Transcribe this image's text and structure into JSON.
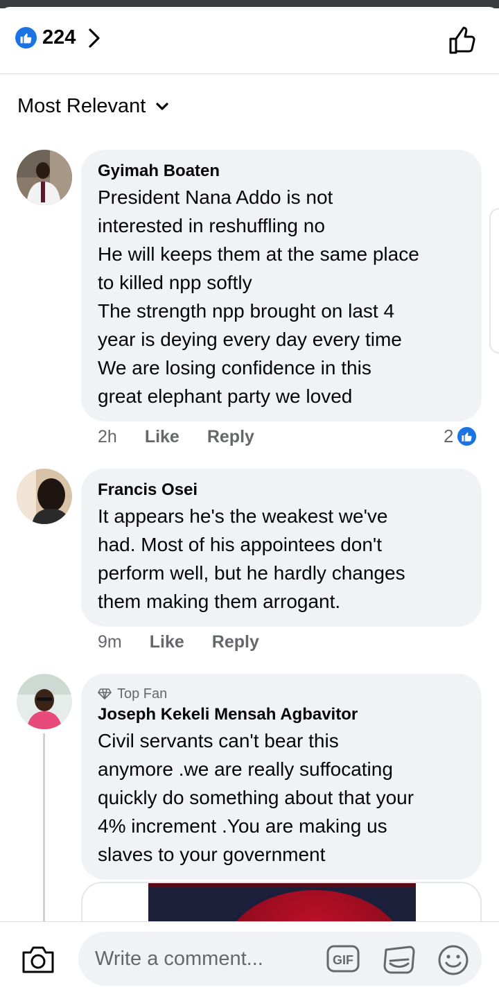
{
  "header": {
    "reaction_count": "224",
    "like_badge_icon": "thumbs-up-icon",
    "accent": "#1b74e4"
  },
  "sort": {
    "label": "Most Relevant"
  },
  "comments": [
    {
      "author": "Gyimah Boaten",
      "text": "President Nana Addo is not\ninterested in reshuffling no\nHe will keeps them at the same place\nto killed npp softly\nThe strength npp brought on last 4\nyear is deying every day every time\nWe are losing confidence in this\ngreat elephant party we loved",
      "time": "2h",
      "like_label": "Like",
      "reply_label": "Reply",
      "reaction_count": "2"
    },
    {
      "author": "Francis Osei",
      "text": "It appears he's the weakest we've\nhad. Most of his appointees don't\nperform well, but he hardly changes\nthem making them arrogant.",
      "time": "9m",
      "like_label": "Like",
      "reply_label": "Reply"
    },
    {
      "badge": "Top Fan",
      "author": "Joseph Kekeli Mensah Agbavitor",
      "text": "Civil servants can't bear this\nanymore .we are really suffocating\nquickly do something about that your\n4% increment .You are making us\nslaves to your government"
    }
  ],
  "composer": {
    "placeholder": "Write a comment...",
    "gif_label": "GIF"
  }
}
